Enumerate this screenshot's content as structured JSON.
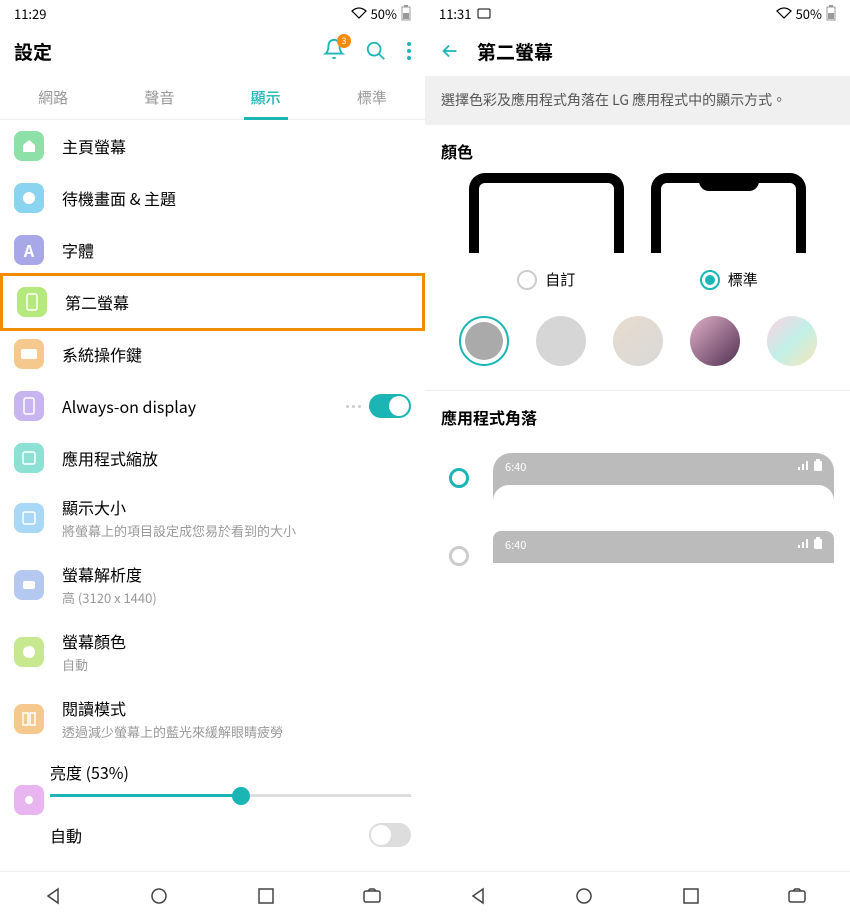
{
  "left": {
    "status": {
      "time": "11:29",
      "battery": "50%"
    },
    "header": {
      "title": "設定",
      "notif_count": "3"
    },
    "tabs": [
      "網路",
      "聲音",
      "顯示",
      "標準"
    ],
    "items": [
      {
        "icon_bg": "#8de0a8",
        "title": "主頁螢幕",
        "sub": ""
      },
      {
        "icon_bg": "#8bd4f0",
        "title": "待機畫面 & 主題",
        "sub": ""
      },
      {
        "icon_bg": "#a8a8e8",
        "title": "字體",
        "sub": ""
      },
      {
        "icon_bg": "#b5e87d",
        "title": "第二螢幕",
        "sub": ""
      },
      {
        "icon_bg": "#f5c98e",
        "title": "系統操作鍵",
        "sub": ""
      },
      {
        "icon_bg": "#c8b5f0",
        "title": "Always-on display",
        "sub": "",
        "toggle": true,
        "dots": true
      },
      {
        "icon_bg": "#8de0d4",
        "title": "應用程式縮放",
        "sub": ""
      },
      {
        "icon_bg": "#a8d8f5",
        "title": "顯示大小",
        "sub": "將螢幕上的項目設定成您易於看到的大小"
      },
      {
        "icon_bg": "#b5c8f0",
        "title": "螢幕解析度",
        "sub": "高 (3120 x 1440)"
      },
      {
        "icon_bg": "#c8e890",
        "title": "螢幕顏色",
        "sub": "自動"
      },
      {
        "icon_bg": "#f5c98e",
        "title": "閱讀模式",
        "sub": "透過減少螢幕上的藍光來緩解眼睛疲勞"
      }
    ],
    "brightness": {
      "label": "亮度 (53%)",
      "auto_label": "自動"
    }
  },
  "right": {
    "status": {
      "time": "11:31",
      "battery": "50%"
    },
    "header": {
      "title": "第二螢幕"
    },
    "desc": "選擇色彩及應用程式角落在 LG 應用程式中的顯示方式。",
    "color_section": "顏色",
    "radios": [
      {
        "label": "自訂",
        "checked": false
      },
      {
        "label": "標準",
        "checked": true
      }
    ],
    "swatches": [
      {
        "bg": "#aaa",
        "selected": true
      },
      {
        "bg": "#d0d0d0"
      },
      {
        "bg": "linear-gradient(135deg,#e8d8c8,#d8d8d8)"
      },
      {
        "bg": "linear-gradient(135deg,#e0b0c8,#503050)"
      },
      {
        "bg": "linear-gradient(135deg,#ffd1dc,#c1f0e8,#f5e6a8)"
      }
    ],
    "corner_section": "應用程式角落",
    "corner_time": "6:40",
    "corners": [
      {
        "checked": true,
        "rounded": true
      },
      {
        "checked": false,
        "rounded": false
      }
    ]
  }
}
